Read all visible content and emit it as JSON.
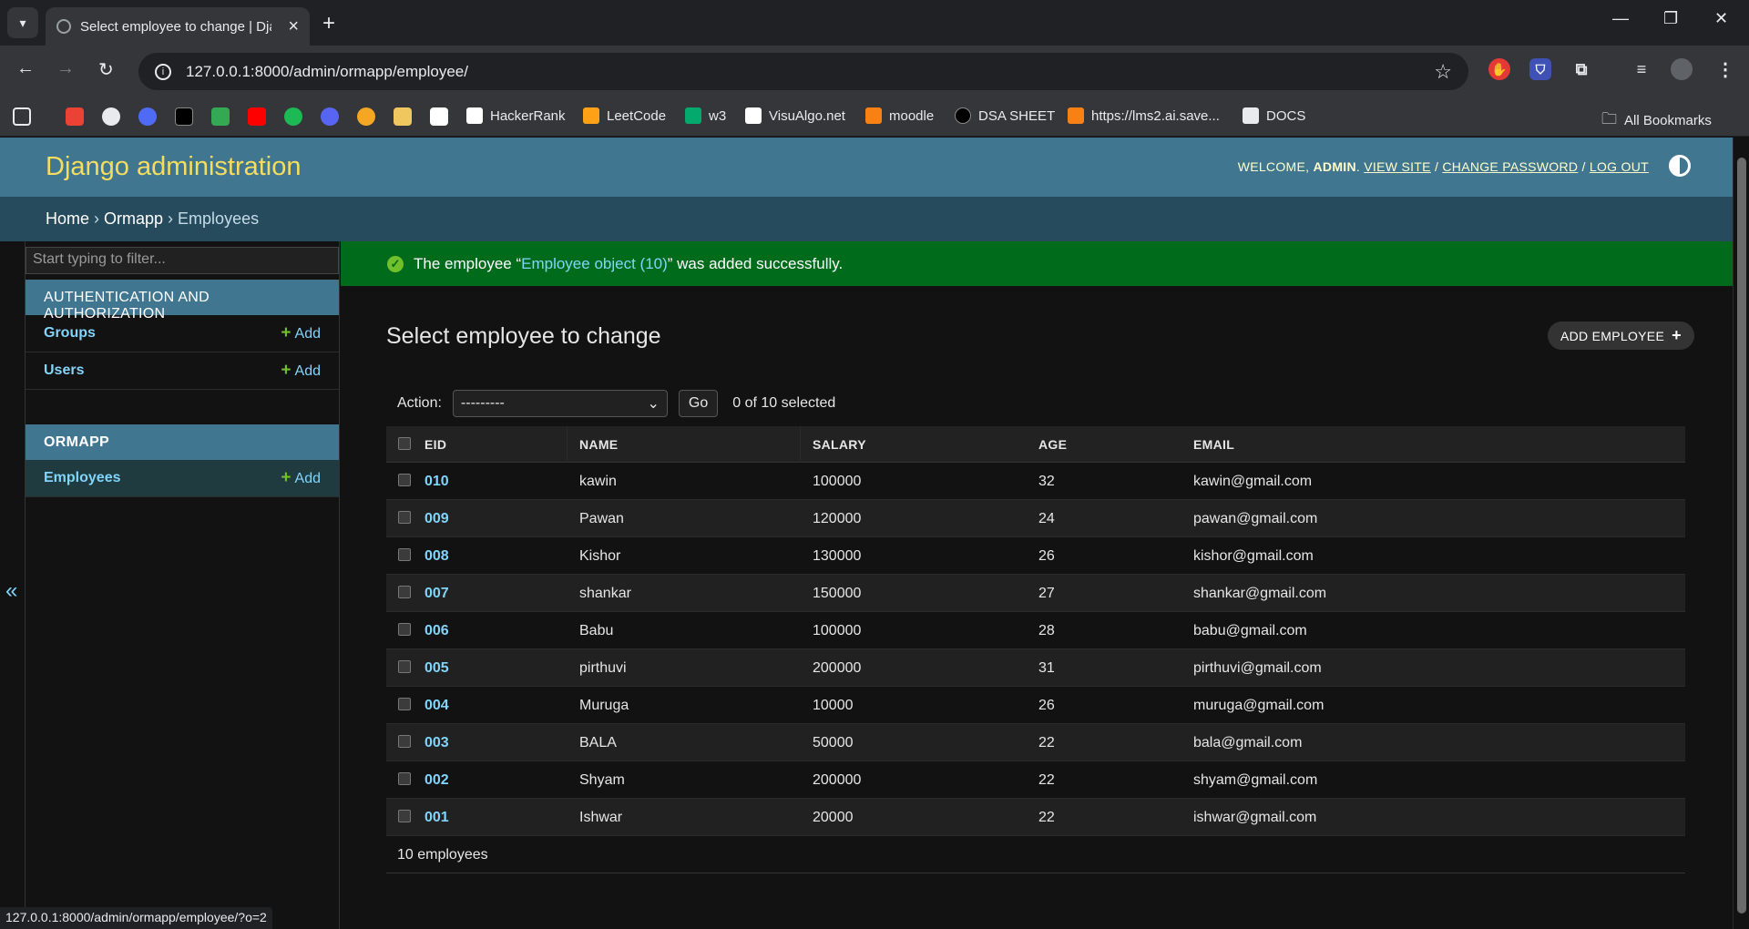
{
  "browser": {
    "tab_title": "Select employee to change | Dja",
    "url": "127.0.0.1:8000/admin/ormapp/employee/",
    "status_url": "127.0.0.1:8000/admin/ormapp/employee/?o=2",
    "bookmarks": [
      "HackerRank",
      "LeetCode",
      "w3",
      "VisuAlgo.net",
      "moodle",
      "DSA SHEET",
      "https://lms2.ai.save...",
      "DOCS"
    ],
    "all_bookmarks_label": "All Bookmarks"
  },
  "admin": {
    "site_title": "Django administration",
    "welcome": "WELCOME, ",
    "user": "ADMIN",
    "view_site": "VIEW SITE",
    "change_password": "CHANGE PASSWORD",
    "log_out": "LOG OUT",
    "breadcrumb": {
      "home": "Home",
      "app": "Ormapp",
      "model": "Employees"
    }
  },
  "sidebar": {
    "filter_placeholder": "Start typing to filter...",
    "auth_caption": "AUTHENTICATION AND AUTHORIZATION",
    "groups_label": "Groups",
    "users_label": "Users",
    "app_caption": "ORMAPP",
    "employees_label": "Employees",
    "add_label": "Add",
    "collapse_glyph": "«"
  },
  "message": {
    "prefix": "The employee “",
    "link": "Employee object (10)",
    "suffix": "” was added successfully."
  },
  "page": {
    "title": "Select employee to change",
    "add_button": "ADD EMPLOYEE",
    "action_label": "Action:",
    "action_value": "---------",
    "go_label": "Go",
    "selected_count": "0 of 10 selected",
    "columns": [
      "EID",
      "NAME",
      "SALARY",
      "AGE",
      "EMAIL"
    ],
    "rows": [
      [
        "010",
        "kawin",
        "100000",
        "32",
        "kawin@gmail.com"
      ],
      [
        "009",
        "Pawan",
        "120000",
        "24",
        "pawan@gmail.com"
      ],
      [
        "008",
        "Kishor",
        "130000",
        "26",
        "kishor@gmail.com"
      ],
      [
        "007",
        "shankar",
        "150000",
        "27",
        "shankar@gmail.com"
      ],
      [
        "006",
        "Babu",
        "100000",
        "28",
        "babu@gmail.com"
      ],
      [
        "005",
        "pirthuvi",
        "200000",
        "31",
        "pirthuvi@gmail.com"
      ],
      [
        "004",
        "Muruga",
        "10000",
        "26",
        "muruga@gmail.com"
      ],
      [
        "003",
        "BALA",
        "50000",
        "22",
        "bala@gmail.com"
      ],
      [
        "002",
        "Shyam",
        "200000",
        "22",
        "shyam@gmail.com"
      ],
      [
        "001",
        "Ishwar",
        "20000",
        "22",
        "ishwar@gmail.com"
      ]
    ],
    "paginator": "10 employees"
  },
  "colors": {
    "header_bg": "#417690",
    "breadcrumb_bg": "#264b5d",
    "success_bg": "#006b1b",
    "link": "#81d4fa",
    "branding": "#f5dd5d"
  }
}
